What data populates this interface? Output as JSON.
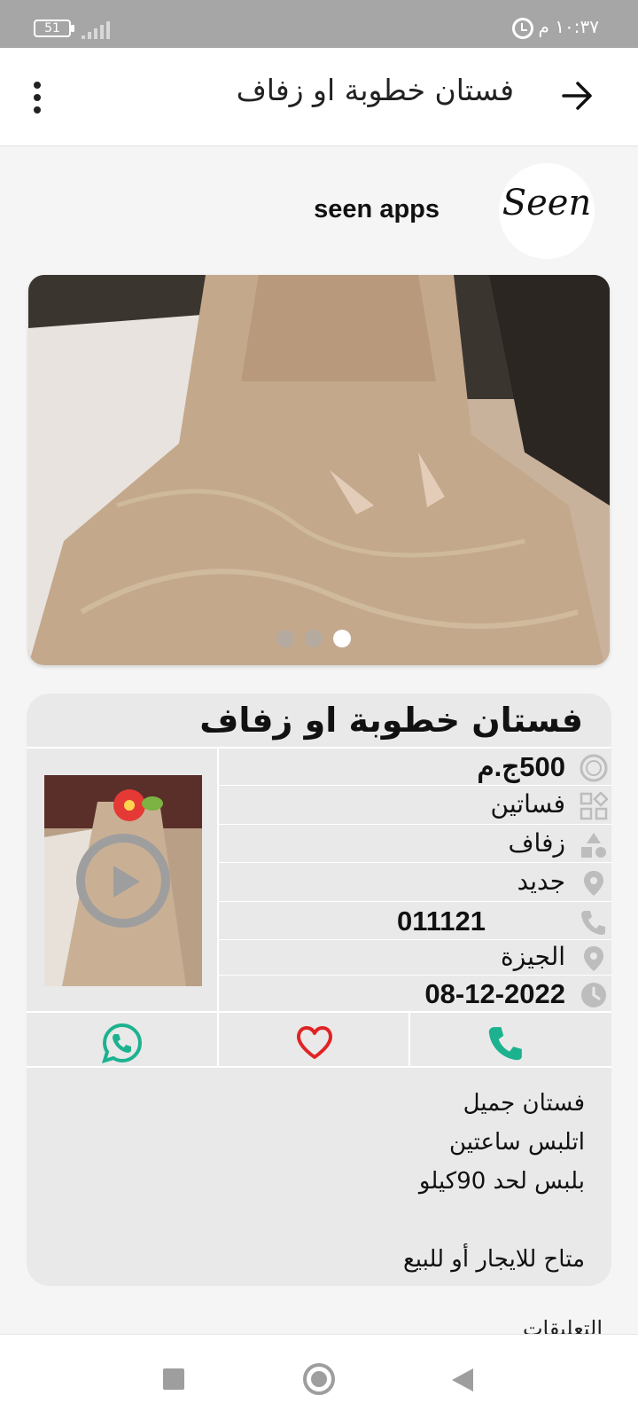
{
  "status_bar": {
    "battery_level": "51",
    "time": "١٠:٣٧ م"
  },
  "app_bar": {
    "title": "فستان خطوبة او زفاف",
    "back_icon": "arrow-right-icon",
    "menu_icon": "more-vertical-icon"
  },
  "seller": {
    "logo_text": "Seen",
    "name": "seen apps"
  },
  "gallery": {
    "image": "dress-photo",
    "page_count": 3,
    "active_page": 3
  },
  "listing": {
    "title": "فستان خطوبة او زفاف",
    "details": [
      {
        "icon": "price-icon",
        "value": "500ج.م",
        "bold": true
      },
      {
        "icon": "category-icon",
        "value": "فساتين",
        "bold": false
      },
      {
        "icon": "shapes-icon",
        "value": "زفاف",
        "bold": false
      },
      {
        "icon": "location-pin-icon",
        "value": "جديد",
        "bold": false
      },
      {
        "icon": "phone-icon",
        "value": "011121",
        "bold": true
      },
      {
        "icon": "location-pin-icon",
        "value": "الجيزة",
        "bold": false
      },
      {
        "icon": "clock-icon",
        "value": "08-12-2022",
        "bold": true
      }
    ],
    "actions": {
      "whatsapp_icon": "whatsapp-icon",
      "favorite_icon": "heart-icon",
      "call_icon": "phone-icon"
    },
    "description": "فستان جميل\nاتلبس ساعتين\nبلبس لحد 90كيلو\n\nمتاح للايجار أو للبيع"
  },
  "comments": {
    "label": "التعليقات"
  },
  "colors": {
    "accent_green": "#1db28f",
    "favorite_red": "#e02424",
    "status_bar": "#a6a6a6",
    "card_bg": "#e9e9e9"
  }
}
